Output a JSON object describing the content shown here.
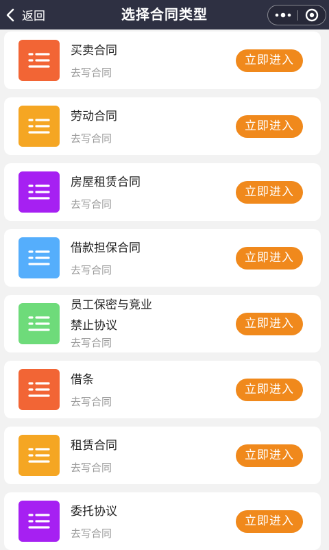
{
  "navbar": {
    "back_label": "返回",
    "title": "选择合同类型",
    "menu_icon": "more-dots-icon",
    "close_icon": "target-close-icon",
    "background": "#2e3042"
  },
  "button_label": "立即进入",
  "button_color": "#f0891c",
  "contracts": [
    {
      "name": "买卖合同",
      "sub": "去写合同",
      "color": "#f26535",
      "icon": "document-lines-icon"
    },
    {
      "name": "劳动合同",
      "sub": "去写合同",
      "color": "#f5a623",
      "icon": "document-lines-icon"
    },
    {
      "name": "房屋租赁合同",
      "sub": "去写合同",
      "color": "#a620f2",
      "icon": "document-lines-icon"
    },
    {
      "name": "借款担保合同",
      "sub": "去写合同",
      "color": "#55aefc",
      "icon": "document-lines-icon"
    },
    {
      "name": "员工保密与竞业禁止协议",
      "sub": "去写合同",
      "color": "#6edb7a",
      "icon": "document-lines-icon"
    },
    {
      "name": "借条",
      "sub": "去写合同",
      "color": "#f26535",
      "icon": "document-lines-icon"
    },
    {
      "name": "租赁合同",
      "sub": "去写合同",
      "color": "#f5a623",
      "icon": "document-lines-icon"
    },
    {
      "name": "委托协议",
      "sub": "去写合同",
      "color": "#a620f2",
      "icon": "document-lines-icon"
    }
  ]
}
